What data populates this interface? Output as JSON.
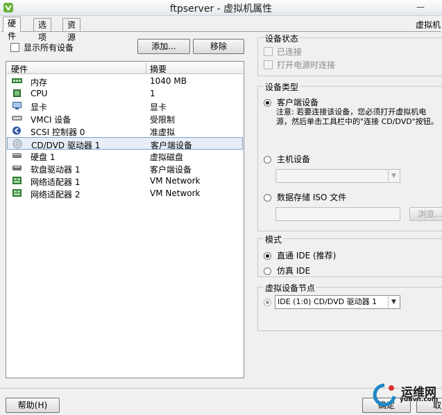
{
  "window": {
    "title": "ftpserver - 虚拟机属性"
  },
  "tabs": [
    {
      "label": "硬件"
    },
    {
      "label": "选项"
    },
    {
      "label": "资源"
    }
  ],
  "tab_right_label": "虚拟机",
  "hardware": {
    "show_all_label": "显示所有设备",
    "add_label": "添加...",
    "remove_label": "移除",
    "columns": {
      "hardware": "硬件",
      "summary": "摘要"
    },
    "rows": [
      {
        "name": "内存",
        "summary": "1040 MB",
        "icon": "memory-icon"
      },
      {
        "name": "CPU",
        "summary": "1",
        "icon": "cpu-icon"
      },
      {
        "name": "显卡",
        "summary": "显卡",
        "icon": "display-icon"
      },
      {
        "name": "VMCI 设备",
        "summary": "受限制",
        "icon": "vmci-icon"
      },
      {
        "name": "SCSI 控制器 0",
        "summary": "准虚拟",
        "icon": "scsi-icon"
      },
      {
        "name": "CD/DVD 驱动器 1",
        "summary": "客户端设备",
        "icon": "cdrom-icon",
        "selected": true
      },
      {
        "name": "硬盘 1",
        "summary": "虚拟磁盘",
        "icon": "harddisk-icon"
      },
      {
        "name": "软盘驱动器 1",
        "summary": "客户端设备",
        "icon": "floppy-icon"
      },
      {
        "name": "网络适配器 1",
        "summary": "VM Network",
        "icon": "network-adapter-icon"
      },
      {
        "name": "网络适配器 2",
        "summary": "VM Network",
        "icon": "network-adapter-icon"
      }
    ]
  },
  "device_status": {
    "title": "设备状态",
    "connected_label": "已连接",
    "connect_on_power_label": "打开电源时连接"
  },
  "device_type": {
    "title": "设备类型",
    "client_device_label": "客户端设备",
    "client_note_line1": "注意: 若要连接该设备，您必须打开虚拟机电",
    "client_note_line2": "源，然后单击工具栏中的\"连接 CD/DVD\"按钮。",
    "host_device_label": "主机设备",
    "host_device_value": "",
    "iso_label": "数据存储 ISO 文件",
    "iso_value": "",
    "browse_label": "浏览..."
  },
  "mode": {
    "title": "模式",
    "passthrough_label": "直通 IDE (推荐)",
    "emulate_label": "仿真 IDE"
  },
  "virtual_node": {
    "title": "虚拟设备节点",
    "value": "IDE (1:0) CD/DVD 驱动器 1"
  },
  "footer": {
    "help_label": "帮助(H)",
    "ok_label": "确定",
    "cancel_label": "取"
  },
  "watermark": {
    "text1": "运维网",
    "text2": "yunvn.com"
  }
}
